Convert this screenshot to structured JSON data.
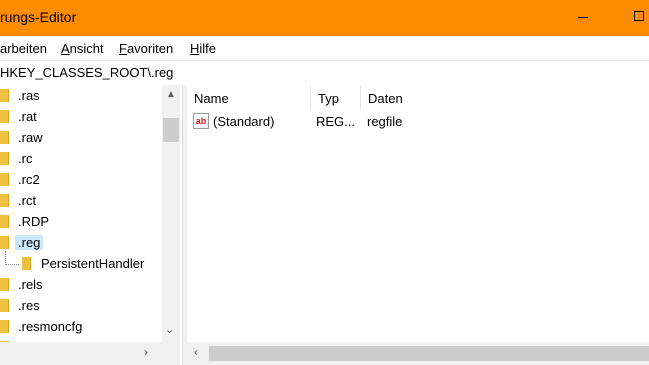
{
  "window": {
    "title": "rungs-Editor"
  },
  "menu": {
    "items": [
      {
        "label": "arbeiten",
        "underline": ""
      },
      {
        "label": "Ansicht",
        "underline": "A"
      },
      {
        "label": "Favoriten",
        "underline": "F"
      },
      {
        "label": "Hilfe",
        "underline": "H"
      }
    ]
  },
  "address": {
    "path": "HKEY_CLASSES_ROOT\\.reg"
  },
  "tree": {
    "items": [
      {
        "label": ".ras"
      },
      {
        "label": ".rat"
      },
      {
        "label": ".raw"
      },
      {
        "label": ".rc"
      },
      {
        "label": ".rc2"
      },
      {
        "label": ".rct"
      },
      {
        "label": ".RDP"
      },
      {
        "label": ".reg",
        "selected": true
      },
      {
        "label": "PersistentHandler",
        "child": true
      },
      {
        "label": ".rels"
      },
      {
        "label": ".res"
      },
      {
        "label": ".resmoncfg"
      }
    ]
  },
  "list": {
    "columns": [
      {
        "label": "Name"
      },
      {
        "label": "Typ"
      },
      {
        "label": "Daten"
      }
    ],
    "rows": [
      {
        "name": "(Standard)",
        "type": "REG...",
        "data": "regfile",
        "icon": "string-value-icon"
      }
    ]
  },
  "colors": {
    "titlebar": "#ff8c00",
    "selection": "#cce8ff",
    "folder": "#f0c040"
  }
}
